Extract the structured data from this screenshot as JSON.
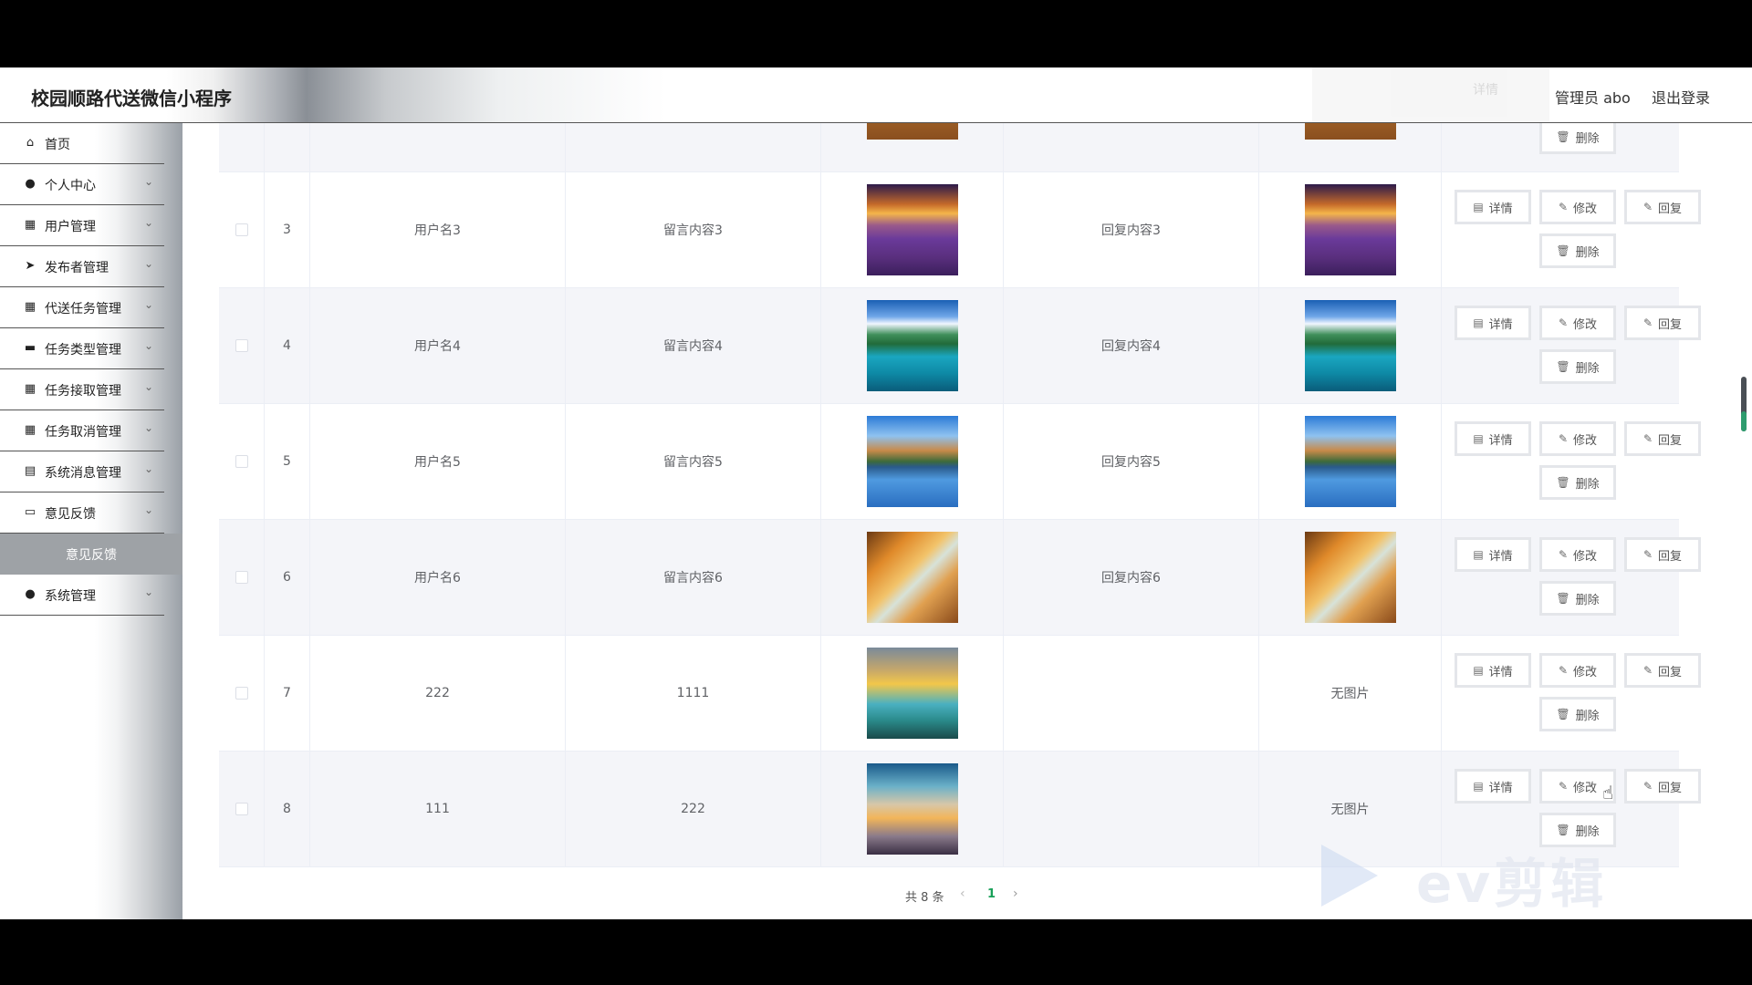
{
  "header": {
    "app_title": "校园顺路代送微信小程序",
    "ghost_text": "详情",
    "admin_label": "管理员 abo",
    "logout_label": "退出登录"
  },
  "sidebar": {
    "items": [
      {
        "label": "首页",
        "icon": "home-icon",
        "glyph": "⌂",
        "has_arrow": false
      },
      {
        "label": "个人中心",
        "icon": "user-icon",
        "glyph": "●",
        "has_arrow": true
      },
      {
        "label": "用户管理",
        "icon": "grid-icon",
        "glyph": "▦",
        "has_arrow": true
      },
      {
        "label": "发布者管理",
        "icon": "send-icon",
        "glyph": "➤",
        "has_arrow": true
      },
      {
        "label": "代送任务管理",
        "icon": "grid-icon",
        "glyph": "▦",
        "has_arrow": true
      },
      {
        "label": "任务类型管理",
        "icon": "comment-icon",
        "glyph": "▬",
        "has_arrow": true
      },
      {
        "label": "任务接取管理",
        "icon": "grid-icon",
        "glyph": "▦",
        "has_arrow": true
      },
      {
        "label": "任务取消管理",
        "icon": "grid-icon",
        "glyph": "▦",
        "has_arrow": true
      },
      {
        "label": "系统消息管理",
        "icon": "clipboard-icon",
        "glyph": "▤",
        "has_arrow": true
      },
      {
        "label": "意见反馈",
        "icon": "briefcase-icon",
        "glyph": "▭",
        "has_arrow": true
      }
    ],
    "active_sub": "意见反馈",
    "last_item": {
      "label": "系统管理",
      "icon": "admin-icon",
      "glyph": "●",
      "has_arrow": true
    },
    "arrow_glyph": "⌄"
  },
  "actions": {
    "detail": "详情",
    "edit": "修改",
    "reply": "回复",
    "delete": "删除"
  },
  "rows": [
    {
      "index": "3",
      "username": "用户名3",
      "message": "留言内容3",
      "reply": "回复内容3",
      "image": "img-sunset-lavender",
      "reply_image": "img-sunset-lavender",
      "no_image_text": ""
    },
    {
      "index": "4",
      "username": "用户名4",
      "message": "留言内容4",
      "reply": "回复内容4",
      "image": "img-tropical",
      "reply_image": "img-tropical",
      "no_image_text": ""
    },
    {
      "index": "5",
      "username": "用户名5",
      "message": "留言内容5",
      "reply": "回复内容5",
      "image": "img-lake-reflect",
      "reply_image": "img-lake-reflect",
      "no_image_text": ""
    },
    {
      "index": "6",
      "username": "用户名6",
      "message": "留言内容6",
      "reply": "回复内容6",
      "image": "img-autumn",
      "reply_image": "img-autumn",
      "no_image_text": ""
    },
    {
      "index": "7",
      "username": "222",
      "message": "1111",
      "reply": "",
      "image": "img-sky-sea",
      "reply_image": "",
      "no_image_text": "无图片"
    },
    {
      "index": "8",
      "username": "111",
      "message": "222",
      "reply": "",
      "image": "img-road-sunset",
      "reply_image": "",
      "no_image_text": "无图片"
    }
  ],
  "pagination": {
    "total_text": "共 8 条",
    "prev_glyph": "‹",
    "current_page": "1",
    "next_glyph": "›"
  },
  "watermark": {
    "text": "ev剪辑"
  }
}
